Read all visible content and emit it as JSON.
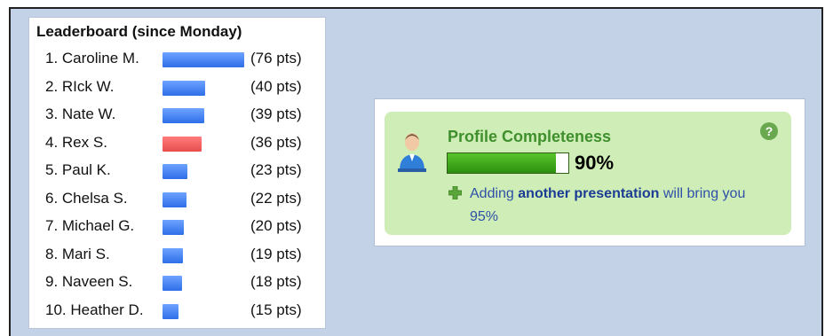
{
  "leaderboard": {
    "title": "Leaderboard (since Monday)",
    "entries": [
      {
        "rank_name": "1. Caroline M.",
        "points": "(76 pts)",
        "value": 76,
        "highlight": false
      },
      {
        "rank_name": "2. RIck W.",
        "points": "(40 pts)",
        "value": 40,
        "highlight": false
      },
      {
        "rank_name": "3. Nate W.",
        "points": "(39 pts)",
        "value": 39,
        "highlight": false
      },
      {
        "rank_name": "4. Rex S.",
        "points": "(36 pts)",
        "value": 36,
        "highlight": true
      },
      {
        "rank_name": "5. Paul K.",
        "points": "(23 pts)",
        "value": 23,
        "highlight": false
      },
      {
        "rank_name": "6. Chelsa S.",
        "points": "(22 pts)",
        "value": 22,
        "highlight": false
      },
      {
        "rank_name": "7. Michael G.",
        "points": "(20 pts)",
        "value": 20,
        "highlight": false
      },
      {
        "rank_name": "8. Mari S.",
        "points": "(19 pts)",
        "value": 19,
        "highlight": false
      },
      {
        "rank_name": "9. Naveen S.",
        "points": "(18 pts)",
        "value": 18,
        "highlight": false
      },
      {
        "rank_name": "10. Heather D.",
        "points": "(15 pts)",
        "value": 15,
        "highlight": false
      }
    ]
  },
  "profile": {
    "title": "Profile Completeness",
    "percent_text": "90%",
    "progress_fraction": 0.9,
    "help_glyph": "?",
    "message_prefix": "Adding ",
    "message_link": "another presentation",
    "message_suffix": " will bring you 95%"
  },
  "icons": {
    "avatar": "user-avatar-icon",
    "help": "help-icon",
    "plus": "plus-icon"
  },
  "colors": {
    "background": "#c4d2e7",
    "bar_blue": "#2e6ee8",
    "bar_red": "#e84e4e",
    "profile_bg": "#cfeeb7",
    "title_green": "#3f8f2d",
    "link_blue": "#1b3c94"
  }
}
